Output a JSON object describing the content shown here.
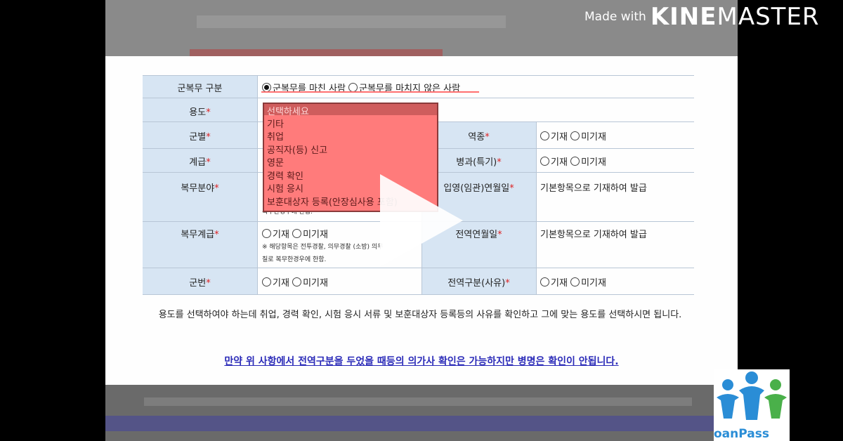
{
  "watermark": {
    "made_with": "Made with",
    "brand_bold": "KINE",
    "brand_light": "MASTER"
  },
  "form": {
    "row_service_type": {
      "label": "군복무 구분",
      "opt1": "군복무를 마친 사람",
      "opt2": "군복무를 마치지 않은 사람"
    },
    "row_purpose": {
      "label": "용도"
    },
    "row_branch": {
      "label": "군별",
      "right_label": "역종",
      "right_opt1": "기재",
      "right_opt2": "미기재"
    },
    "row_rank": {
      "label": "계급",
      "right_label": "병과(특기)",
      "right_opt1": "기재",
      "right_opt2": "미기재"
    },
    "row_field": {
      "label": "복무분야",
      "right_label": "입영(임관)연월일",
      "right_value": "기본항목으로 기재하여 발급",
      "note": "복무한경우에 한함."
    },
    "row_service_rank": {
      "label": "복무계급",
      "opt1": "기재",
      "opt2": "미기재",
      "note1": "※ 해당항목은 전투경찰, 의무경찰 (소방) 의무",
      "note2": "칠로 복무한경우에 한함.",
      "right_label": "전역연월일",
      "right_value": "기본항목으로 기재하여 발급"
    },
    "row_number": {
      "label": "군번",
      "opt1": "기재",
      "opt2": "미기재",
      "right_label": "전역구분(사유)",
      "right_opt1": "기재",
      "right_opt2": "미기재"
    },
    "required_mark": "*"
  },
  "dropdown": {
    "items": [
      "선택하세요",
      "기타",
      "취업",
      "공직자(등) 신고",
      "영문",
      "경력 확인",
      "시험 응시",
      "보훈대상자 등록(안장심사용 포함)"
    ]
  },
  "description": "용도를 선택하여야 하는데 취업, 경력 확인, 시험 응시 서류 및 보훈대상자 등록등의 사유를 확인하고 그에 맞는 용도를 선택하시면 됩니다.",
  "link_text": "만약 위 사항에서 전역구분을 두었을 때등의 의가사 확인은 가능하지만 병명은 확인이 안됩니다.",
  "logo": {
    "text": "oanPass"
  }
}
